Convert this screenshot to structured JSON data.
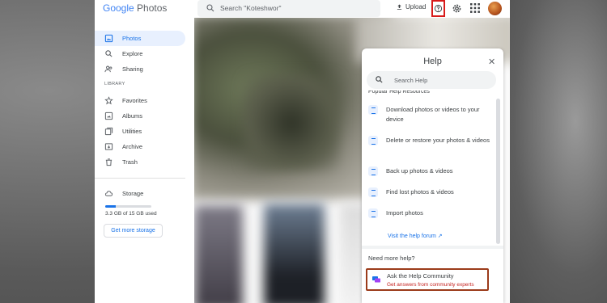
{
  "app": {
    "logo_google": "Google",
    "logo_product": "Photos",
    "search_placeholder": "Search \"Koteshwor\"",
    "upload_label": "Upload"
  },
  "sidebar": {
    "items": [
      {
        "label": "Photos",
        "icon": "photo-icon"
      },
      {
        "label": "Explore",
        "icon": "search-icon"
      },
      {
        "label": "Sharing",
        "icon": "people-icon"
      }
    ],
    "library_label": "LIBRARY",
    "library_items": [
      {
        "label": "Favorites",
        "icon": "star-icon"
      },
      {
        "label": "Albums",
        "icon": "album-icon"
      },
      {
        "label": "Utilities",
        "icon": "utilities-icon"
      },
      {
        "label": "Archive",
        "icon": "archive-icon"
      },
      {
        "label": "Trash",
        "icon": "trash-icon"
      }
    ],
    "storage": {
      "label": "Storage",
      "usage_text": "3.3 GB of 15 GB used",
      "used_fraction": 0.22,
      "more_button": "Get more storage"
    }
  },
  "help_panel": {
    "title": "Help",
    "search_placeholder": "Search Help",
    "resources_heading": "Popular Help Resources",
    "resources": [
      "Download photos or videos to your device",
      "Delete or restore your photos & videos",
      "Back up photos & videos",
      "Find lost photos & videos",
      "Import photos"
    ],
    "forum_link": "Visit the help forum",
    "need_more": "Need more help?",
    "community_title": "Ask the Help Community",
    "community_subtitle": "Get answers from community experts"
  },
  "colors": {
    "accent": "#1a73e8",
    "highlight_box": "#d81b1b",
    "community_box": "#9b3b1a"
  }
}
